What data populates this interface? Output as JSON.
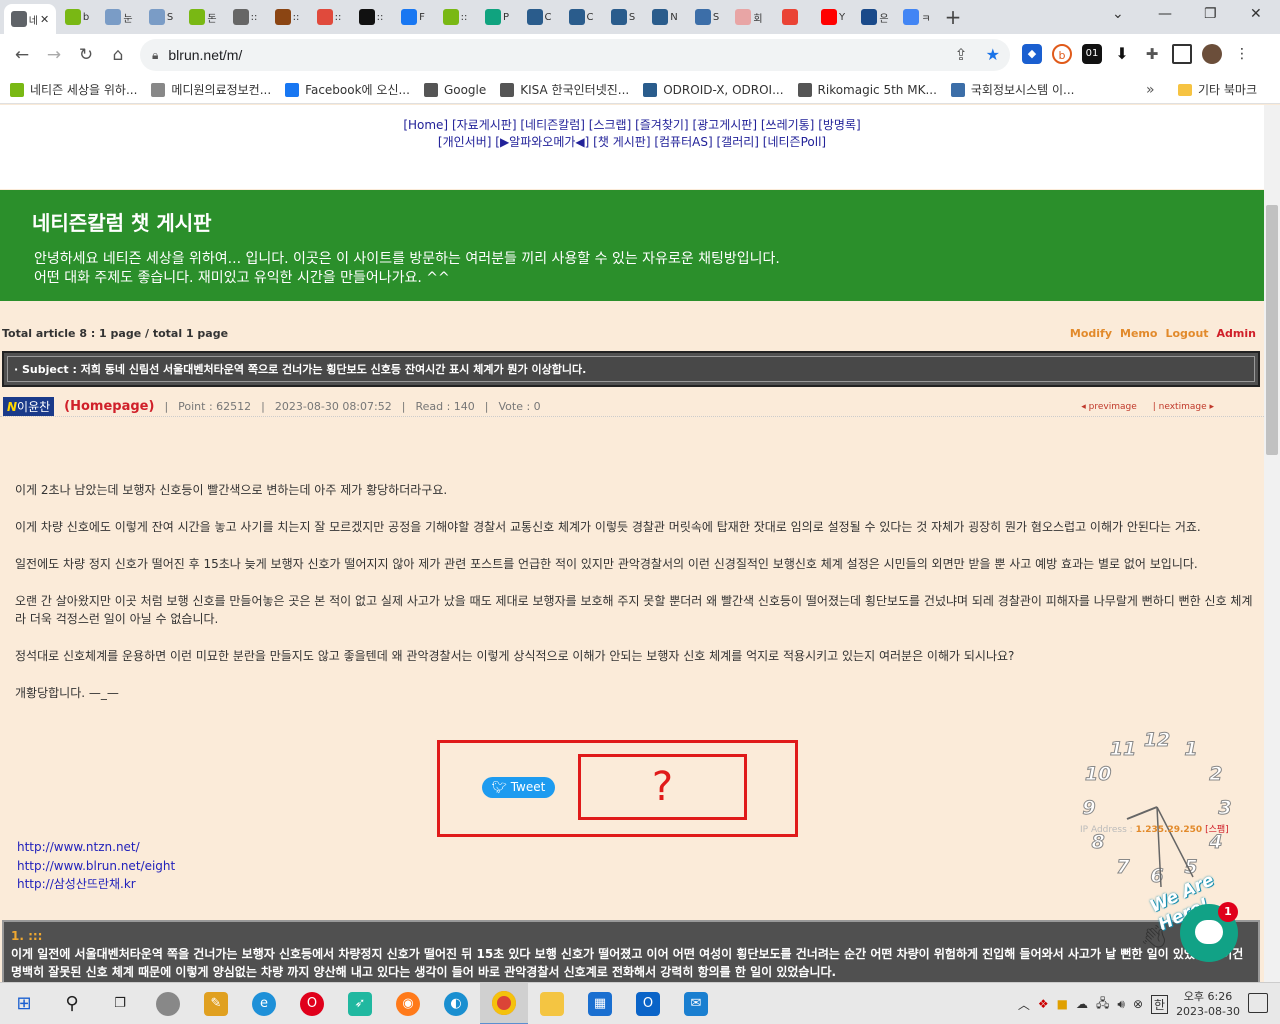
{
  "browser": {
    "tabs": [
      {
        "icon": "list-icon",
        "label": "네",
        "color": "#5f6368",
        "active": true
      },
      {
        "icon": "leaf-icon",
        "label": "b",
        "color": "#79b814"
      },
      {
        "icon": "globe-icon",
        "label": "눈",
        "color": "#7a9cc6"
      },
      {
        "icon": "globe-icon",
        "label": "S",
        "color": "#7a9cc6"
      },
      {
        "icon": "leaf-icon",
        "label": "돈",
        "color": "#79b814"
      },
      {
        "icon": "ball-icon",
        "label": "::",
        "color": "#666666"
      },
      {
        "icon": "seal-icon",
        "label": "::",
        "color": "#8b4513"
      },
      {
        "icon": "puzzle-icon",
        "label": "::",
        "color": "#e04a3c"
      },
      {
        "icon": "x-icon",
        "label": "::",
        "color": "#111111"
      },
      {
        "icon": "facebook-icon",
        "label": "F",
        "color": "#1877f2"
      },
      {
        "icon": "leaf-icon",
        "label": "::",
        "color": "#79b814"
      },
      {
        "icon": "openai-icon",
        "label": "P",
        "color": "#10a37f"
      },
      {
        "icon": "building-icon",
        "label": "C",
        "color": "#2a5c8c"
      },
      {
        "icon": "building-icon",
        "label": "C",
        "color": "#2a5c8c"
      },
      {
        "icon": "building-icon",
        "label": "S",
        "color": "#2a5c8c"
      },
      {
        "icon": "building-icon",
        "label": "N",
        "color": "#2a5c8c"
      },
      {
        "icon": "table-icon",
        "label": "S",
        "color": "#3c6ea8"
      },
      {
        "icon": "mail-icon",
        "label": "회",
        "color": "#e8a5a5"
      },
      {
        "icon": "gmail-icon",
        "label": "",
        "color": "#ea4335"
      },
      {
        "icon": "youtube-icon",
        "label": "Y",
        "color": "#ff0000"
      },
      {
        "icon": "wp-icon",
        "label": "은",
        "color": "#1a4a8a"
      },
      {
        "icon": "c-icon",
        "label": "ㅋ",
        "color": "#4285f4"
      }
    ],
    "url": "blrun.net/m/",
    "bookmarks": [
      {
        "icon": "leaf-icon",
        "label": "네티즌 세상을 위하...",
        "color": "#79b814"
      },
      {
        "icon": "ball-icon",
        "label": "메디원의료정보컨...",
        "color": "#888888"
      },
      {
        "icon": "facebook-icon",
        "label": "Facebook에 오신...",
        "color": "#1877f2"
      },
      {
        "icon": "globe-icon",
        "label": "Google",
        "color": "#555555"
      },
      {
        "icon": "globe-icon",
        "label": "KISA 한국인터넷진...",
        "color": "#555555"
      },
      {
        "icon": "building-icon",
        "label": "ODROID-X, ODROI...",
        "color": "#2a5c8c"
      },
      {
        "icon": "globe-icon",
        "label": "Rikomagic 5th MK...",
        "color": "#555555"
      },
      {
        "icon": "gov-icon",
        "label": "국회정보시스템 이...",
        "color": "#3c6ea8"
      }
    ],
    "more": "»",
    "other_bookmarks": "기타 북마크"
  },
  "nav": {
    "row1": [
      "[Home]",
      "[자료게시판]",
      "[네티즌칼럼]",
      "[스크랩]",
      "[즐겨찾기]",
      "[광고게시판]",
      "[쓰레기통]",
      "[방명록]"
    ],
    "row2": [
      "[개인서버]",
      "[▶알파와오메가◀]",
      "[챗 게시판]",
      "[컴퓨터AS]",
      "[갤러리]",
      "[네티즌Poll]"
    ]
  },
  "banner": {
    "title": "네티즌칼럼 챗 게시판",
    "line1": "안녕하세요 네티즌 세상을 위하여... 입니다. 이곳은 이 사이트를 방문하는 여러분들 끼리 사용할 수 있는 자유로운 채팅방입니다.",
    "line2": "어떤 대화 주제도 좋습니다. 재미있고 유익한 시간을 만들어나가요. ^^"
  },
  "info": {
    "total": "Total article 8 :   1 page / total 1 page",
    "actions": [
      "Modify",
      "Memo",
      "Logout"
    ],
    "admin": "Admin"
  },
  "post": {
    "subject_label": "· Subject :",
    "subject": "저희 동네 신림선 서울대벤처타운역 쪽으로 건너가는 횡단보도 신호등 잔여시간 표시 체계가 뭔가 이상합니다.",
    "badge_n": "N",
    "author": "이윤찬",
    "homepage": "(Homepage)",
    "point": "Point : 62512",
    "date": "2023-08-30 08:07:52",
    "read": "Read : 140",
    "vote": "Vote : 0",
    "prev": "◂ previmage",
    "next": "| nextimage ▸",
    "paragraphs": [
      "이게 2초나 남았는데 보행자 신호등이 빨간색으로 변하는데 아주 제가 황당하더라구요.",
      "이게 차량 신호에도 이렇게 잔여 시간을 놓고 사기를 치는지 잘 모르겠지만 공정을 기해야할 경찰서 교통신호 체계가 이렇듯 경찰관 머릿속에 탑재한 잣대로 임의로 설정될 수 있다는 것 자체가 굉장히 뭔가 혐오스럽고 이해가 안된다는 거죠.",
      "일전에도 차량 정지 신호가 떨어진 후 15초나 늦게 보행자 신호가 떨어지지 않아 제가 관련 포스트를 언급한 적이 있지만 관악경찰서의 이런 신경질적인 보행신호 체계 설정은 시민들의 외면만 받을 뿐 사고 예방 효과는 별로 없어 보입니다.",
      "오랜 간 살아왔지만 이곳 처럼 보행 신호를 만들어놓은 곳은 본 적이 없고 실제 사고가 났을 때도 제대로 보행자를 보호해 주지 못할 뿐더러 왜 빨간색 신호등이 떨어졌는데 횡단보도를 건넜냐며 되레 경찰관이 피해자를 나무랄게 뻔하디 뻔한 신호 체계라 더욱 걱정스런 일이 아닐 수 없습니다.",
      "정석대로 신호체계를 운용하면 이런 미묘한 분란을 만들지도 않고 좋을텐데 왜 관악경찰서는 이렇게 상식적으로 이해가 안되는 보행자 신호 체계를 억지로 적용시키고 있는지 여러분은 이해가 되시나요?",
      "개황당합니다. —_—"
    ],
    "tweet": "Tweet",
    "placeholder": "?",
    "links": [
      "http://www.ntzn.net/",
      "http://www.blrun.net/eight",
      "http://삼성산뜨란채.kr"
    ]
  },
  "clock": {
    "numbers": [
      "12",
      "1",
      "2",
      "3",
      "4",
      "5",
      "6",
      "7",
      "8",
      "9",
      "10",
      "11"
    ]
  },
  "ip": {
    "label": "IP Address :",
    "value": "1.235.29.250",
    "spam": "[스팸]"
  },
  "comment": {
    "num": "1. :::",
    "text": "이게 일전에 서울대벤처타운역 쪽을 건너가는 보행자 신호등에서 차량정지 신호가 떨어진 뒤 15초 있다 보행 신호가 떨어졌고 이어 어떤 여성이 횡단보도를 건너려는 순간 어떤 차량이 위험하게 진입해 들어와서 사고가 날 뻔한 일이 있었는데 이건 명백히 잘못된 신호 체계 때문에 이렇게 양심없는 차량 까지 양산해 내고 있다는 생각이 들어 바로 관악경찰서 신호계로 전화해서 강력히 항의를 한 일이 있었습니다."
  },
  "chat": {
    "badge": "1",
    "tagline": "We Are Here!"
  },
  "taskbar": {
    "time": "오후 6:26",
    "date": "2023-08-30",
    "ime": "한"
  }
}
